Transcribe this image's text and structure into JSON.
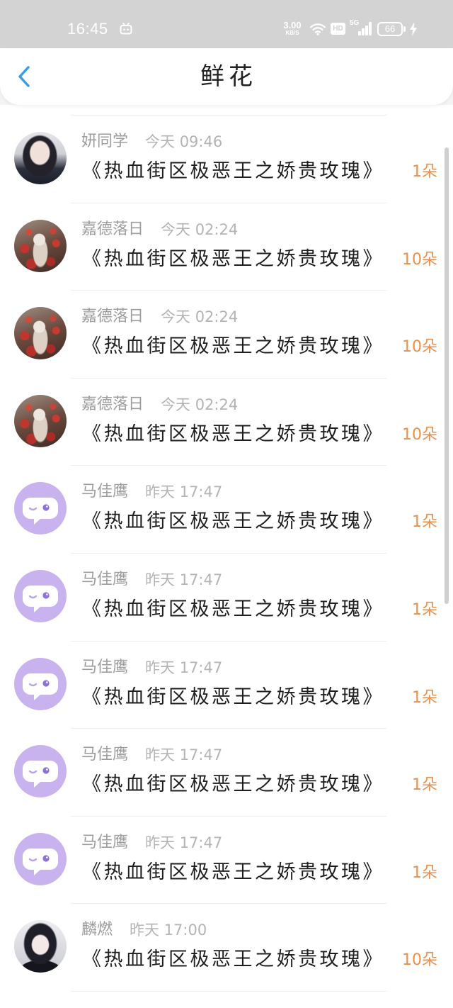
{
  "status_bar": {
    "time": "16:45",
    "speed_value": "3.00",
    "speed_unit": "KB/S",
    "hd_label": "HD",
    "network_label": "5G",
    "battery_level": "66",
    "icons": [
      "tv-app-notification-icon",
      "wifi-icon",
      "hd-icon",
      "cellular-signal-icon",
      "battery-icon",
      "charging-icon"
    ]
  },
  "header": {
    "back_icon": "chevron-left-icon",
    "title": "鲜花"
  },
  "colors": {
    "status_bar_bg": "#d3d3d3",
    "accent": "#3a9ce4",
    "count_text": "#e8904d",
    "default_avatar_bg": "#c8b3ef",
    "name_text": "#9d9d9d",
    "time_text": "#b4b4b4",
    "book_text": "#1f1f1f"
  },
  "items": [
    {
      "avatar": "photo-girl",
      "name": "妍同学",
      "time": "今天 09:46",
      "book": "《热血街区极恶王之娇贵玫瑰》",
      "count": "1朵"
    },
    {
      "avatar": "photo-floral-art",
      "name": "嘉德落日",
      "time": "今天 02:24",
      "book": "《热血街区极恶王之娇贵玫瑰》",
      "count": "10朵"
    },
    {
      "avatar": "photo-floral-art",
      "name": "嘉德落日",
      "time": "今天 02:24",
      "book": "《热血街区极恶王之娇贵玫瑰》",
      "count": "10朵"
    },
    {
      "avatar": "photo-floral-art",
      "name": "嘉德落日",
      "time": "今天 02:24",
      "book": "《热血街区极恶王之娇贵玫瑰》",
      "count": "10朵"
    },
    {
      "avatar": "default-chat-bubble-icon",
      "name": "马佳鹰",
      "time": "昨天 17:47",
      "book": "《热血街区极恶王之娇贵玫瑰》",
      "count": "1朵"
    },
    {
      "avatar": "default-chat-bubble-icon",
      "name": "马佳鹰",
      "time": "昨天 17:47",
      "book": "《热血街区极恶王之娇贵玫瑰》",
      "count": "1朵"
    },
    {
      "avatar": "default-chat-bubble-icon",
      "name": "马佳鹰",
      "time": "昨天 17:47",
      "book": "《热血街区极恶王之娇贵玫瑰》",
      "count": "1朵"
    },
    {
      "avatar": "default-chat-bubble-icon",
      "name": "马佳鹰",
      "time": "昨天 17:47",
      "book": "《热血街区极恶王之娇贵玫瑰》",
      "count": "1朵"
    },
    {
      "avatar": "default-chat-bubble-icon",
      "name": "马佳鹰",
      "time": "昨天 17:47",
      "book": "《热血街区极恶王之娇贵玫瑰》",
      "count": "1朵"
    },
    {
      "avatar": "photo-anime",
      "name": "麟燃",
      "time": "昨天 17:00",
      "book": "《热血街区极恶王之娇贵玫瑰》",
      "count": "10朵"
    }
  ]
}
